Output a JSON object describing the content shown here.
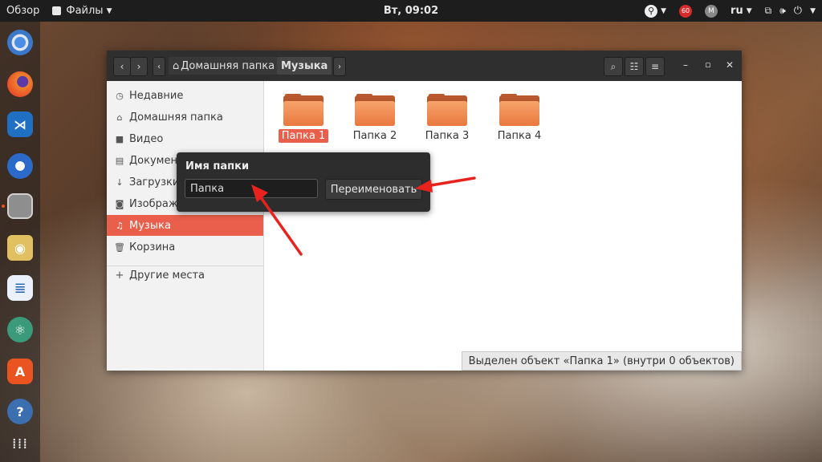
{
  "topbar": {
    "overview": "Обзор",
    "app_menu": "Файлы",
    "clock": "Вт, 09:02",
    "lang": "ru",
    "notif_count": "60"
  },
  "window": {
    "breadcrumb": [
      "Домашняя папка",
      "Музыка"
    ],
    "sidebar": [
      {
        "label": "Недавние",
        "icon": "clock-icon"
      },
      {
        "label": "Домашняя папка",
        "icon": "home-icon"
      },
      {
        "label": "Видео",
        "icon": "video-icon"
      },
      {
        "label": "Документы",
        "icon": "document-icon"
      },
      {
        "label": "Загрузки",
        "icon": "download-icon"
      },
      {
        "label": "Изображения",
        "icon": "camera-icon"
      },
      {
        "label": "Музыка",
        "icon": "music-icon"
      },
      {
        "label": "Корзина",
        "icon": "trash-icon"
      },
      {
        "label": "Другие места",
        "icon": "plus-icon"
      }
    ],
    "folders": [
      "Папка 1",
      "Папка 2",
      "Папка 3",
      "Папка 4"
    ],
    "status": "Выделен объект «Папка 1» (внутри 0 объектов)"
  },
  "rename_popover": {
    "title": "Имя папки",
    "value": "Папка",
    "button": "Переименовать"
  },
  "colors": {
    "accent": "#e95f4b",
    "arrow": "#e8231e",
    "folder": "#e9783e"
  }
}
